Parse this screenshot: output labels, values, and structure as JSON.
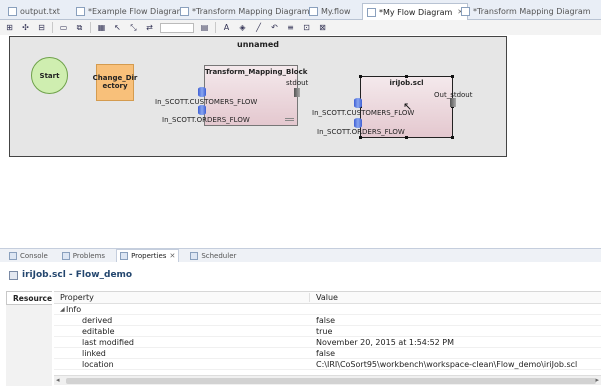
{
  "editor_tabs": [
    {
      "label": "output.txt",
      "active": false
    },
    {
      "label": "*Example Flow Diagram",
      "active": false
    },
    {
      "label": "*Transform Mapping Diagram",
      "active": false
    },
    {
      "label": "My.flow",
      "active": false
    },
    {
      "label": "*My Flow Diagram",
      "active": true
    },
    {
      "label": "*Transform Mapping Diagram",
      "active": false
    }
  ],
  "diagram": {
    "title": "unnamed",
    "start_label": "Start",
    "change_dir_label": "Change_Dir\nectory",
    "block1": {
      "title": "Transform_Mapping_Block",
      "inputs": [
        "In_SCOTT.CUSTOMERS_FLOW",
        "In_SCOTT.ORDERS_FLOW"
      ],
      "output": "stdout"
    },
    "block2": {
      "title": "iriJob.scl",
      "inputs": [
        "In_SCOTT.CUSTOMERS_FLOW",
        "In_SCOTT.ORDERS_FLOW"
      ],
      "output": "Out_stdout"
    }
  },
  "view_tabs": [
    {
      "label": "Console",
      "active": false
    },
    {
      "label": "Problems",
      "active": false
    },
    {
      "label": "Properties",
      "active": true
    },
    {
      "label": "Scheduler",
      "active": false
    }
  ],
  "properties": {
    "title": "iriJob.scl - Flow_demo",
    "side_tab": "Resource",
    "col_property": "Property",
    "col_value": "Value",
    "group": "Info",
    "rows": [
      {
        "property": "derived",
        "value": "false"
      },
      {
        "property": "editable",
        "value": "true"
      },
      {
        "property": "last modified",
        "value": "November 20, 2015 at 1:54:52 PM"
      },
      {
        "property": "linked",
        "value": "false"
      },
      {
        "property": "location",
        "value": "C:\\IRI\\CoSort95\\workbench\\workspace-clean\\Flow_demo\\iriJob.scl"
      }
    ]
  }
}
